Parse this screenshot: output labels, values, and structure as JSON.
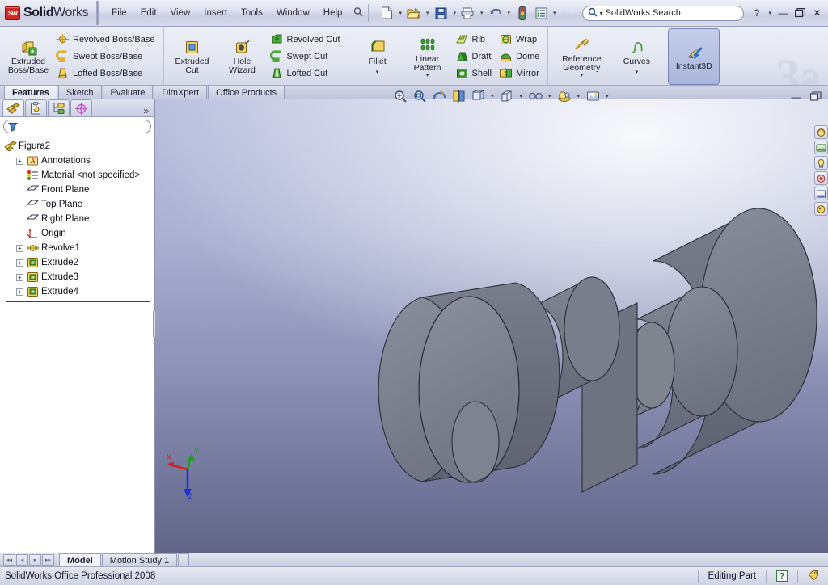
{
  "app": {
    "brand_bold": "Solid",
    "brand_light": "Works",
    "logo_text": "SW",
    "watermark": "3ƨ"
  },
  "menubar": {
    "items": [
      {
        "label": "File"
      },
      {
        "label": "Edit"
      },
      {
        "label": "View"
      },
      {
        "label": "Insert"
      },
      {
        "label": "Tools"
      },
      {
        "label": "Window"
      },
      {
        "label": "Help"
      }
    ],
    "pin_icon": "pushpin-icon"
  },
  "quick_access": {
    "buttons": [
      {
        "name": "new-document-button",
        "icon": "new-document-icon",
        "has_caret": true
      },
      {
        "name": "open-document-button",
        "icon": "open-folder-icon",
        "has_caret": true
      },
      {
        "name": "save-button",
        "icon": "floppy-disk-icon",
        "has_caret": true
      },
      {
        "name": "print-button",
        "icon": "printer-icon",
        "has_caret": true
      },
      {
        "name": "undo-button",
        "icon": "undo-arrow-icon",
        "has_caret": true
      },
      {
        "name": "rebuild-button",
        "icon": "traffic-light-icon",
        "has_caret": false
      },
      {
        "name": "options-button",
        "icon": "options-list-icon",
        "has_caret": true
      },
      {
        "name": "overflow-button",
        "icon": "ellipsis-icon",
        "has_caret": false
      }
    ]
  },
  "search": {
    "placeholder": "SolidWorks Search",
    "icon": "search-magnifier-icon",
    "caret": "▾"
  },
  "window_controls": {
    "help": "?",
    "help_caret": "▾",
    "minimize": "—",
    "restore": "❐",
    "close": "✕"
  },
  "doc_window_controls": {
    "minimize": "—",
    "restore": "restore-window-icon"
  },
  "ribbon": {
    "groups": [
      {
        "name": "boss-base-group",
        "big": {
          "label": "Extruded\nBoss/Base",
          "label_line1": "Extruded",
          "label_line2": "Boss/Base",
          "icon": "extruded-boss-icon",
          "has_caret": false
        },
        "small": [
          {
            "label": "Revolved Boss/Base",
            "icon": "revolved-boss-icon"
          },
          {
            "label": "Swept Boss/Base",
            "icon": "swept-boss-icon"
          },
          {
            "label": "Lofted Boss/Base",
            "icon": "lofted-boss-icon"
          }
        ]
      },
      {
        "name": "cut-group",
        "big": {
          "label_line1": "Extruded",
          "label_line2": "Cut",
          "icon": "extruded-cut-icon",
          "has_caret": false
        },
        "big2": {
          "label_line1": "Hole",
          "label_line2": "Wizard",
          "icon": "hole-wizard-icon",
          "has_caret": false
        },
        "small": [
          {
            "label": "Revolved Cut",
            "icon": "revolved-cut-icon"
          },
          {
            "label": "Swept Cut",
            "icon": "swept-cut-icon"
          },
          {
            "label": "Lofted Cut",
            "icon": "lofted-cut-icon"
          }
        ]
      },
      {
        "name": "feature-group",
        "fillet": {
          "label_line1": "Fillet",
          "label_line2": "",
          "icon": "fillet-icon",
          "has_caret": true
        },
        "pattern": {
          "label_line1": "Linear",
          "label_line2": "Pattern",
          "icon": "linear-pattern-icon",
          "has_caret": true
        },
        "small": [
          {
            "label": "Rib",
            "icon": "rib-icon"
          },
          {
            "label": "Draft",
            "icon": "draft-icon"
          },
          {
            "label": "Shell",
            "icon": "shell-icon"
          }
        ],
        "small2": [
          {
            "label": "Wrap",
            "icon": "wrap-icon"
          },
          {
            "label": "Dome",
            "icon": "dome-icon"
          },
          {
            "label": "Mirror",
            "icon": "mirror-icon"
          }
        ]
      },
      {
        "name": "reference-group",
        "ref": {
          "label_line1": "Reference",
          "label_line2": "Geometry",
          "icon": "reference-geometry-icon",
          "has_caret": true
        },
        "curves": {
          "label_line1": "Curves",
          "label_line2": "",
          "icon": "curves-icon",
          "has_caret": true
        }
      },
      {
        "name": "instant3d-group",
        "instant3d": {
          "label_line1": "Instant3D",
          "label_line2": "",
          "icon": "instant3d-icon",
          "pressed": true
        }
      }
    ]
  },
  "command_tabs": [
    {
      "label": "Features",
      "active": true
    },
    {
      "label": "Sketch",
      "active": false
    },
    {
      "label": "Evaluate",
      "active": false
    },
    {
      "label": "DimXpert",
      "active": false
    },
    {
      "label": "Office Products",
      "active": false
    }
  ],
  "left_panel": {
    "tabs": [
      {
        "name": "feature-manager-tab",
        "icon": "feature-tree-icon",
        "active": true
      },
      {
        "name": "property-manager-tab",
        "icon": "property-clipboard-icon",
        "active": false
      },
      {
        "name": "configuration-manager-tab",
        "icon": "configuration-icon",
        "active": false
      },
      {
        "name": "dimxpert-manager-tab",
        "icon": "dimxpert-target-icon",
        "active": false
      }
    ],
    "more_icon": "»",
    "filter": {
      "placeholder": "",
      "value": "",
      "icon": "filter-funnel-icon"
    },
    "tree": [
      {
        "label": "Figura2",
        "icon": "part-document-icon",
        "depth": 0,
        "expander": "none"
      },
      {
        "label": "Annotations",
        "icon": "annotations-folder-icon",
        "depth": 1,
        "expander": "plus"
      },
      {
        "label": "Material <not specified>",
        "icon": "material-icon",
        "depth": 1,
        "expander": "none"
      },
      {
        "label": "Front Plane",
        "icon": "plane-icon",
        "depth": 1,
        "expander": "none"
      },
      {
        "label": "Top Plane",
        "icon": "plane-icon",
        "depth": 1,
        "expander": "none"
      },
      {
        "label": "Right Plane",
        "icon": "plane-icon",
        "depth": 1,
        "expander": "none"
      },
      {
        "label": "Origin",
        "icon": "origin-icon",
        "depth": 1,
        "expander": "none"
      },
      {
        "label": "Revolve1",
        "icon": "revolve-feature-icon",
        "depth": 1,
        "expander": "plus"
      },
      {
        "label": "Extrude2",
        "icon": "extrude-feature-icon",
        "depth": 1,
        "expander": "plus"
      },
      {
        "label": "Extrude3",
        "icon": "extrude-feature-icon",
        "depth": 1,
        "expander": "plus"
      },
      {
        "label": "Extrude4",
        "icon": "extrude-feature-icon",
        "depth": 1,
        "expander": "plus"
      }
    ]
  },
  "view_toolbar": {
    "buttons": [
      {
        "name": "zoom-to-fit-button",
        "icon": "zoom-to-fit-icon",
        "caret": false
      },
      {
        "name": "zoom-to-area-button",
        "icon": "zoom-to-area-icon",
        "caret": false
      },
      {
        "name": "previous-view-button",
        "icon": "previous-view-icon",
        "caret": false
      },
      {
        "name": "section-view-button",
        "icon": "section-view-icon",
        "caret": false
      },
      {
        "name": "view-orientation-button",
        "icon": "view-orientation-icon",
        "caret": true
      },
      {
        "name": "display-style-button",
        "icon": "display-style-cube-icon",
        "caret": true
      },
      {
        "name": "hide-show-items-button",
        "icon": "hide-show-glasses-icon",
        "caret": true
      },
      {
        "name": "appearances-button",
        "icon": "appearances-sphere-icon",
        "caret": true
      },
      {
        "name": "scene-button",
        "icon": "scene-icon",
        "caret": true
      }
    ]
  },
  "right_toolbar": {
    "buttons": [
      {
        "name": "display-manager-button",
        "icon": "appearance-orb-icon"
      },
      {
        "name": "view-setting-1-button",
        "icon": "scene-green-icon"
      },
      {
        "name": "view-setting-2-button",
        "icon": "light-yellow-icon"
      },
      {
        "name": "view-setting-3-button",
        "icon": "camera-red-icon"
      },
      {
        "name": "view-setting-4-button",
        "icon": "decal-icon"
      },
      {
        "name": "view-setting-5-button",
        "icon": "walkthrough-icon"
      }
    ]
  },
  "triad": {
    "x_label": "X",
    "y_label": "Y",
    "z_label": "Z",
    "x_color": "#d02020",
    "y_color": "#1f9e1f",
    "z_color": "#2030d0"
  },
  "model": {
    "name": "Figura2",
    "face_color": "#7d818f",
    "edge_color": "#2a2c34",
    "description": "stepped shaft revolved part"
  },
  "bottom_tabs": {
    "nav_buttons": [
      "◂◂",
      "◂",
      "▸",
      "▸▸"
    ],
    "tabs": [
      {
        "label": "Model",
        "active": true
      },
      {
        "label": "Motion Study 1",
        "active": false
      }
    ]
  },
  "statusbar": {
    "left_text": "SolidWorks Office Professional 2008",
    "mode_text": "Editing Part",
    "help_badge": "?",
    "tag_icon": "tag-icon"
  },
  "colors": {
    "chrome_light": "#eef0f6",
    "chrome_dark": "#c9cee2",
    "accent_blue": "#2a4a8a",
    "viewport_top": "#b9bfde",
    "viewport_bottom": "#626789",
    "model_gray": "#7d818f"
  }
}
